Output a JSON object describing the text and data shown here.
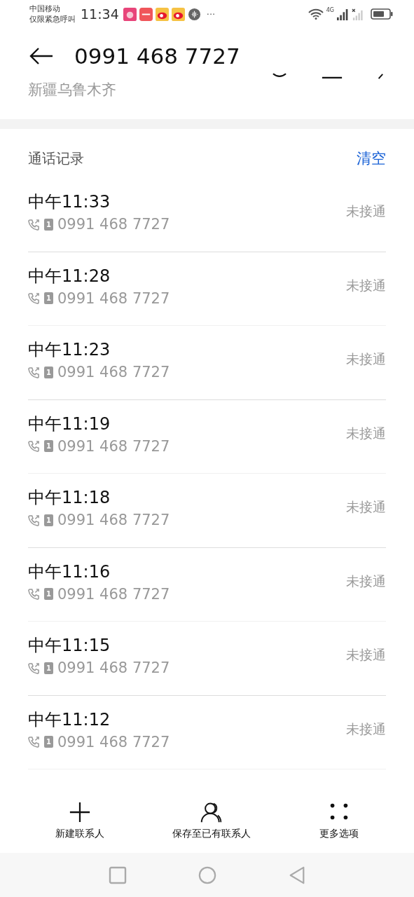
{
  "status_bar": {
    "carrier_lines": [
      "中国移动",
      "仅限紧急呼叫"
    ],
    "time": "11:34",
    "more": "···",
    "network": "4G"
  },
  "header": {
    "title": "0991 468 7727",
    "location": "新疆乌鲁木齐"
  },
  "call_log": {
    "title": "通话记录",
    "clear_label": "清空",
    "rows": [
      {
        "time": "中午11:33",
        "sim": "1",
        "number": "0991 468 7727",
        "status": "未接通"
      },
      {
        "time": "中午11:28",
        "sim": "1",
        "number": "0991 468 7727",
        "status": "未接通"
      },
      {
        "time": "中午11:23",
        "sim": "1",
        "number": "0991 468 7727",
        "status": "未接通"
      },
      {
        "time": "中午11:19",
        "sim": "1",
        "number": "0991 468 7727",
        "status": "未接通"
      },
      {
        "time": "中午11:18",
        "sim": "1",
        "number": "0991 468 7727",
        "status": "未接通"
      },
      {
        "time": "中午11:16",
        "sim": "1",
        "number": "0991 468 7727",
        "status": "未接通"
      },
      {
        "time": "中午11:15",
        "sim": "1",
        "number": "0991 468 7727",
        "status": "未接通"
      },
      {
        "time": "中午11:12",
        "sim": "1",
        "number": "0991 468 7727",
        "status": "未接通"
      }
    ]
  },
  "bottom_actions": [
    {
      "kind": "add",
      "label": "新建联系人"
    },
    {
      "kind": "contact",
      "label": "保存至已有联系人"
    },
    {
      "kind": "more",
      "label": "更多选项"
    }
  ]
}
